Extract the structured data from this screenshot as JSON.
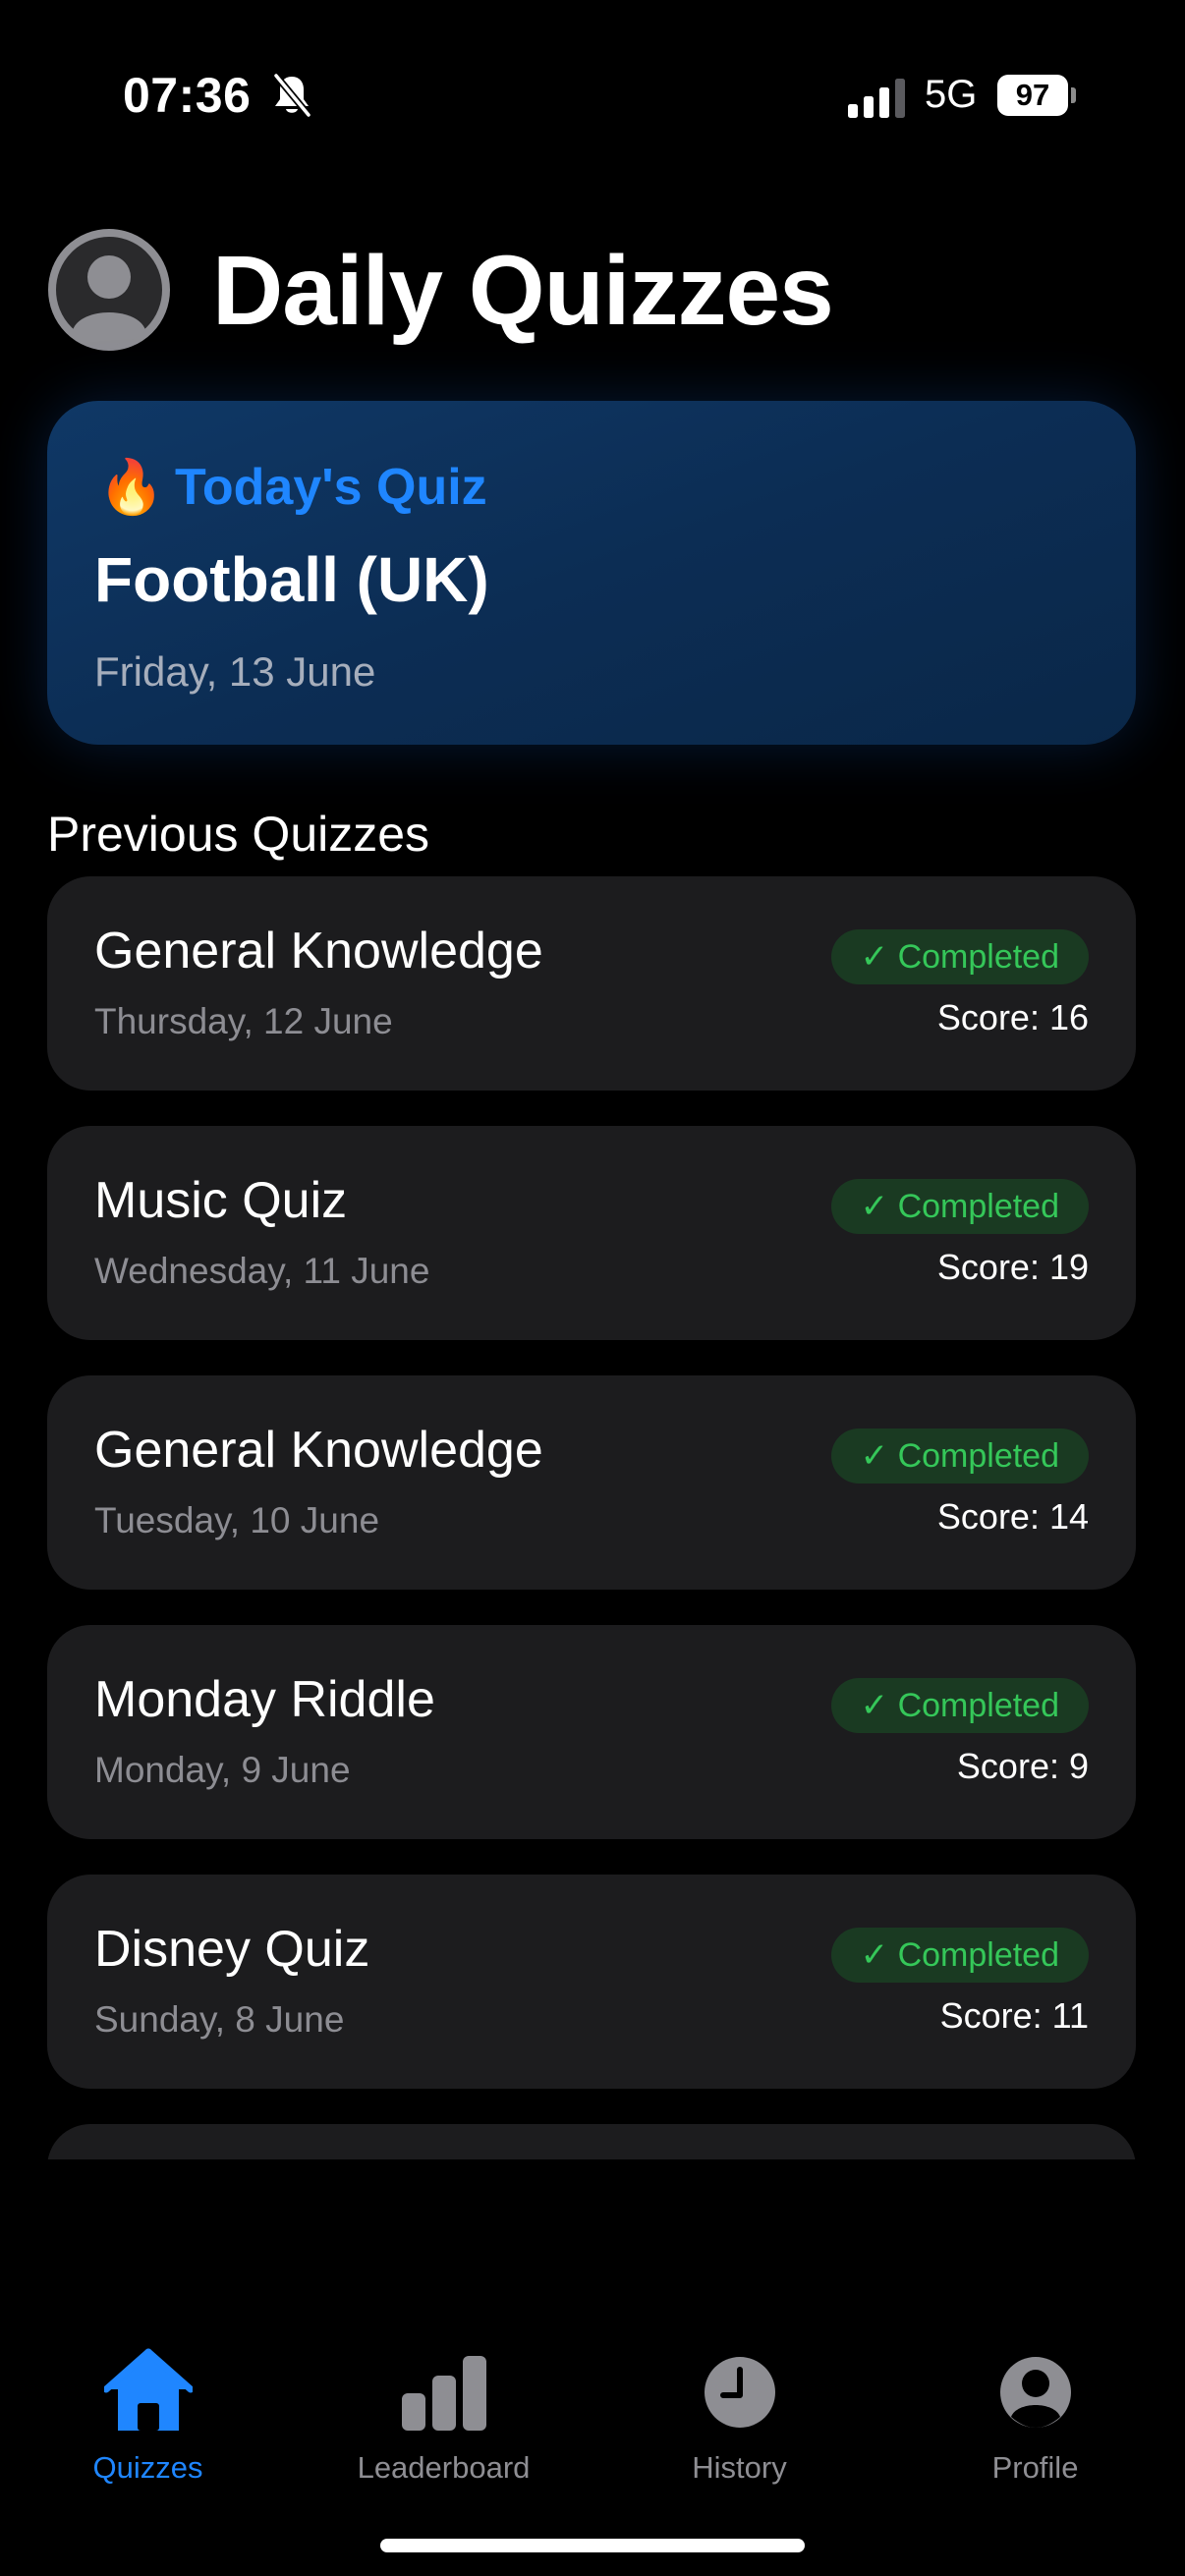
{
  "status_bar": {
    "time": "07:36",
    "network": "5G",
    "battery": "97",
    "icons": [
      "bell-slash-icon",
      "signal-icon",
      "battery-icon"
    ]
  },
  "header": {
    "title": "Daily Quizzes",
    "avatar_icon": "person-circle-icon"
  },
  "today": {
    "emoji": "🔥",
    "label": "Today's Quiz",
    "title": "Football (UK)",
    "date": "Friday, 13 June"
  },
  "previous": {
    "heading": "Previous Quizzes",
    "items": [
      {
        "title": "General Knowledge",
        "date": "Thursday, 12 June",
        "status": "✓ Completed",
        "score": "Score: 16"
      },
      {
        "title": "Music Quiz",
        "date": "Wednesday, 11 June",
        "status": "✓ Completed",
        "score": "Score: 19"
      },
      {
        "title": "General Knowledge",
        "date": "Tuesday, 10 June",
        "status": "✓ Completed",
        "score": "Score: 14"
      },
      {
        "title": "Monday Riddle",
        "date": "Monday, 9 June",
        "status": "✓ Completed",
        "score": "Score: 9"
      },
      {
        "title": "Disney Quiz",
        "date": "Sunday, 8 June",
        "status": "✓ Completed",
        "score": "Score: 11"
      }
    ]
  },
  "tabs": [
    {
      "label": "Quizzes",
      "icon": "house-icon",
      "active": true
    },
    {
      "label": "Leaderboard",
      "icon": "bar-chart-icon",
      "active": false
    },
    {
      "label": "History",
      "icon": "clock-icon",
      "active": false
    },
    {
      "label": "Profile",
      "icon": "person-circle-icon",
      "active": false
    }
  ],
  "colors": {
    "accent": "#1f86ff",
    "success": "#35c759",
    "card": "#1c1c1e",
    "today_card": "#0c2d54",
    "muted": "#8e8e93"
  }
}
